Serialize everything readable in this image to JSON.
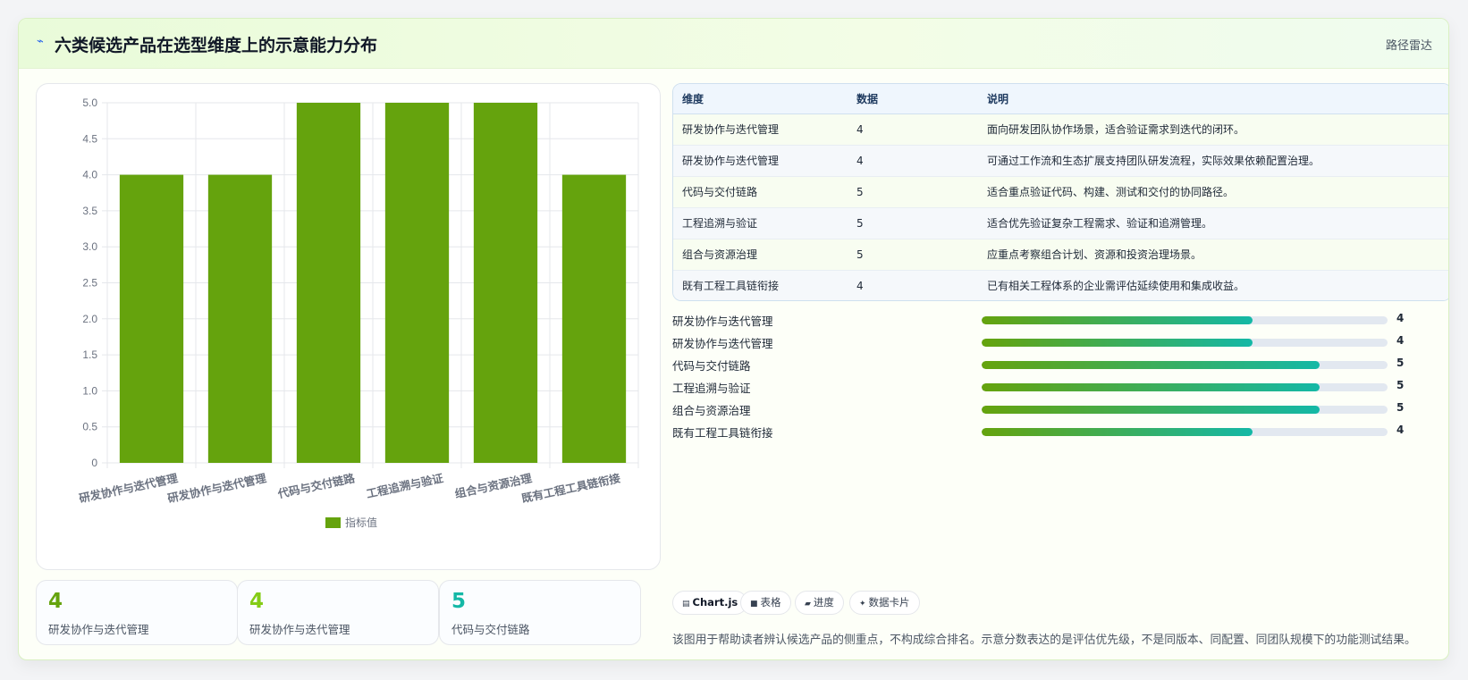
{
  "header": {
    "icon": "sparkline-icon",
    "title": "六类候选产品在选型维度上的示意能力分布",
    "link": "路径雷达"
  },
  "chart_data": {
    "type": "bar",
    "categories": [
      "研发协作与迭代管理",
      "研发协作与迭代管理",
      "代码与交付链路",
      "工程追溯与验证",
      "组合与资源治理",
      "既有工程工具链衔接"
    ],
    "series": [
      {
        "name": "指标值",
        "values": [
          4,
          4,
          5,
          5,
          5,
          4
        ]
      }
    ],
    "ylim": [
      0,
      5
    ],
    "yticks": [
      "0",
      "0.5",
      "1.0",
      "1.5",
      "2.0",
      "2.5",
      "3.0",
      "3.5",
      "4.0",
      "4.5",
      "5.0"
    ],
    "legend": "bottom",
    "grid": true,
    "bar_color": "#65a30d"
  },
  "table": {
    "headers": [
      "维度",
      "数据",
      "说明"
    ],
    "rows": [
      {
        "dim": "研发协作与迭代管理",
        "value": "4",
        "desc": "面向研发团队协作场景，适合验证需求到迭代的闭环。"
      },
      {
        "dim": "研发协作与迭代管理",
        "value": "4",
        "desc": "可通过工作流和生态扩展支持团队研发流程，实际效果依赖配置治理。"
      },
      {
        "dim": "代码与交付链路",
        "value": "5",
        "desc": "适合重点验证代码、构建、测试和交付的协同路径。"
      },
      {
        "dim": "工程追溯与验证",
        "value": "5",
        "desc": "适合优先验证复杂工程需求、验证和追溯管理。"
      },
      {
        "dim": "组合与资源治理",
        "value": "5",
        "desc": "应重点考察组合计划、资源和投资治理场景。"
      },
      {
        "dim": "既有工程工具链衔接",
        "value": "4",
        "desc": "已有相关工程体系的企业需评估延续使用和集成收益。"
      }
    ]
  },
  "progress": {
    "max": 5,
    "items": [
      {
        "label": "研发协作与迭代管理",
        "value": 4,
        "text": "4"
      },
      {
        "label": "研发协作与迭代管理",
        "value": 4,
        "text": "4"
      },
      {
        "label": "代码与交付链路",
        "value": 5,
        "text": "5"
      },
      {
        "label": "工程追溯与验证",
        "value": 5,
        "text": "5"
      },
      {
        "label": "组合与资源治理",
        "value": 5,
        "text": "5"
      },
      {
        "label": "既有工程工具链衔接",
        "value": 4,
        "text": "4"
      }
    ]
  },
  "stats": [
    {
      "value": "4",
      "label": "研发协作与迭代管理",
      "color": "#65a30d"
    },
    {
      "value": "4",
      "label": "研发协作与迭代管理",
      "color": "#84cc16"
    },
    {
      "value": "5",
      "label": "代码与交付链路",
      "color": "#14b8a6"
    }
  ],
  "chips": [
    {
      "icon": "chart-icon",
      "glyph": "▤",
      "label": "Chart.js",
      "bold": true
    },
    {
      "icon": "table-icon",
      "glyph": "■",
      "label": "表格",
      "bold": false
    },
    {
      "icon": "progress-icon",
      "glyph": "▰",
      "label": "进度",
      "bold": false
    },
    {
      "icon": "sparkle-icon",
      "glyph": "✦",
      "label": "数据卡片",
      "bold": false
    }
  ],
  "footnote": "该图用于帮助读者辨认候选产品的侧重点，不构成综合排名。示意分数表达的是评估优先级，不是同版本、同配置、同团队规模下的功能测试结果。"
}
